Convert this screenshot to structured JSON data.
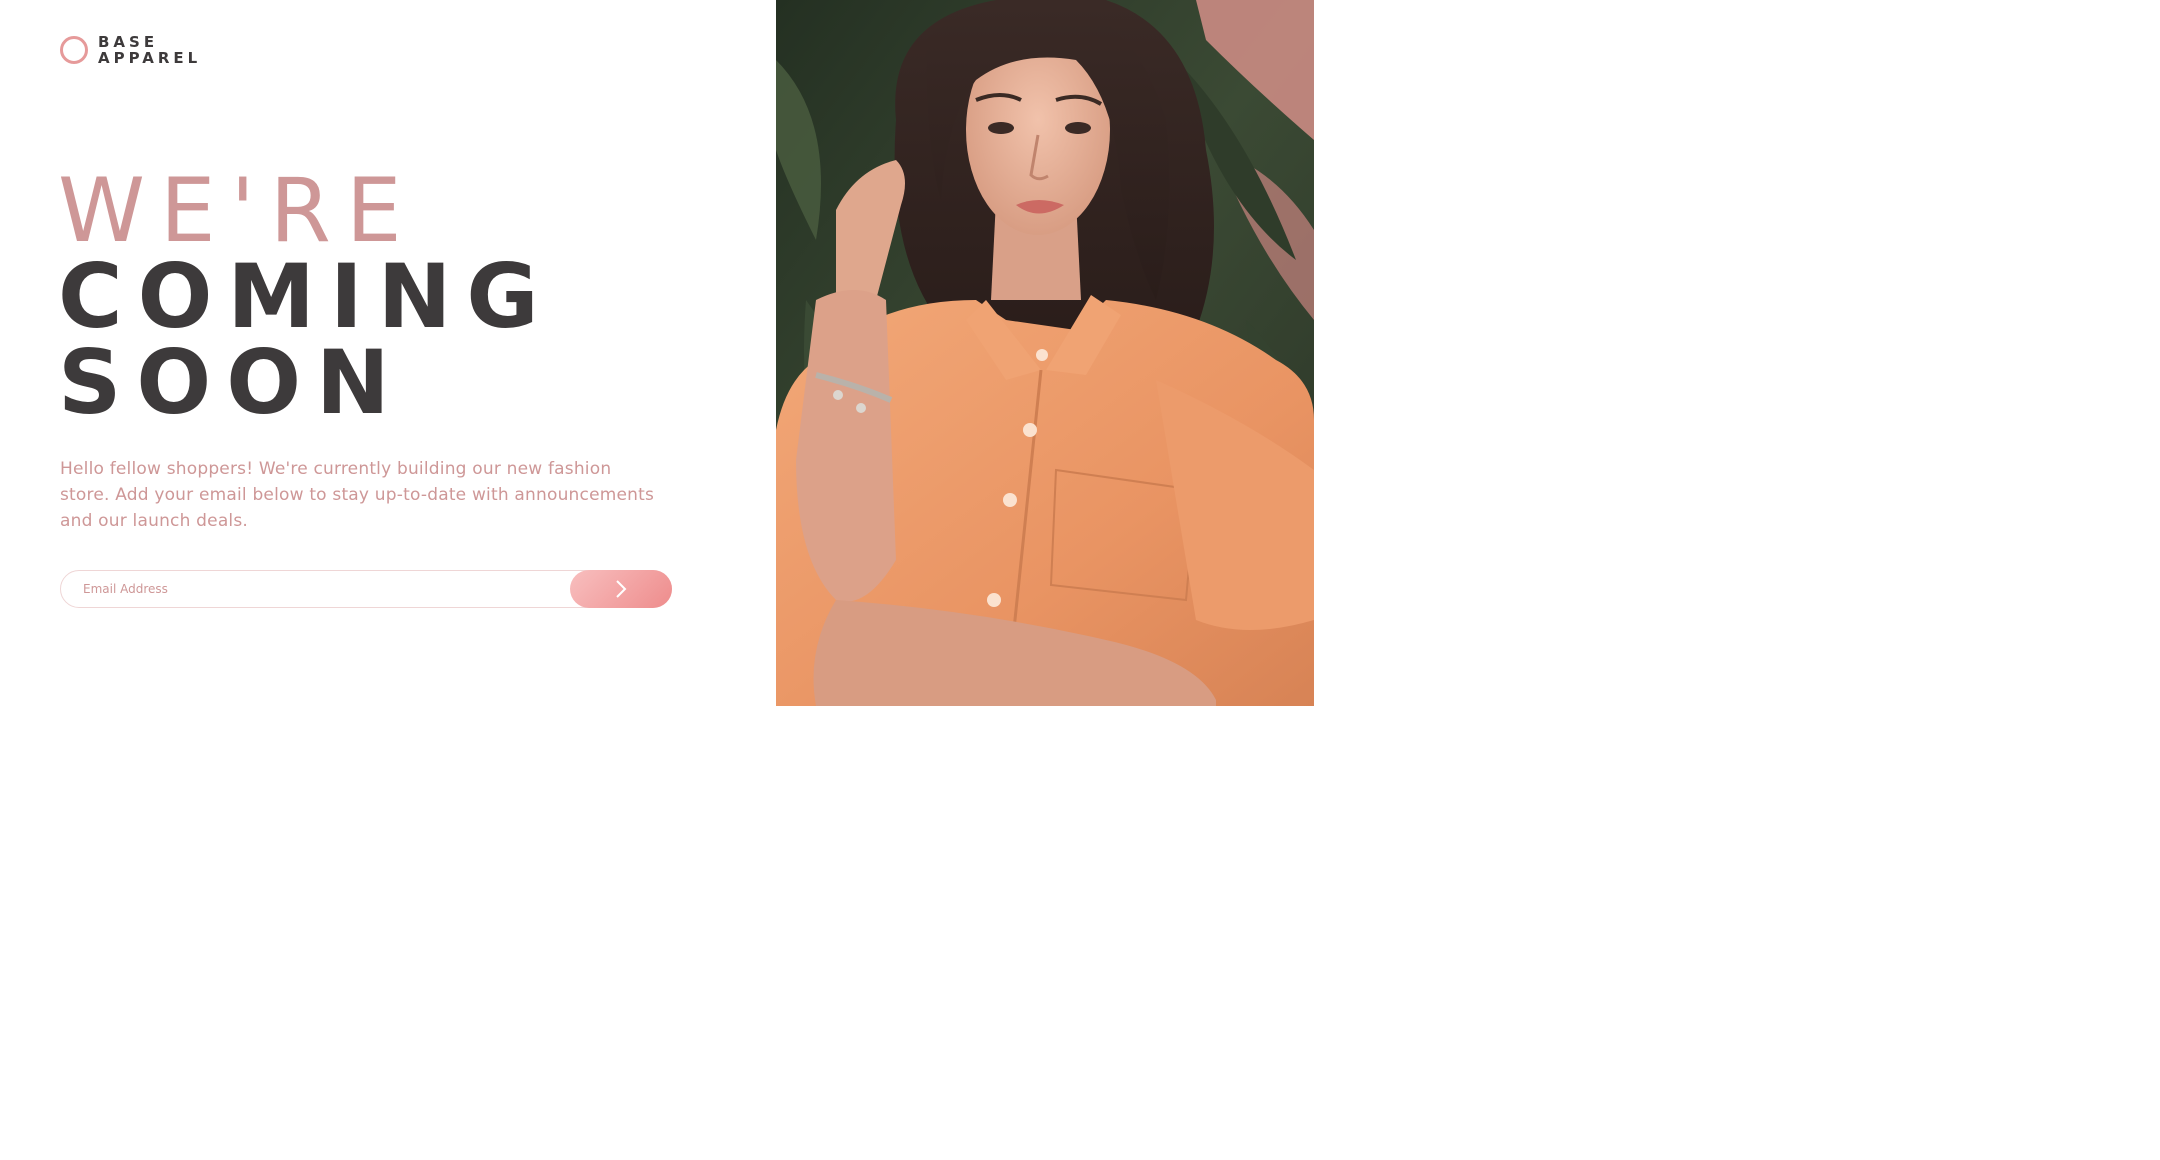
{
  "brand": {
    "line1": "BASE",
    "line2": "APPAREL",
    "logo_icon": "ring-icon",
    "accent_color": "#e69a9a"
  },
  "headline": {
    "line1": "WE'RE",
    "line2": "COMING",
    "line3": "SOON"
  },
  "description": "Hello fellow shoppers! We're currently building our new fashion store. Add your email below to stay up-to-date with announcements and our launch deals.",
  "form": {
    "email_placeholder": "Email Address",
    "submit_icon": "chevron-right-icon",
    "submit_label": "Submit"
  },
  "hero": {
    "image_alt": "Woman in an orange shirt posing among tropical leaves"
  },
  "colors": {
    "primary_text": "#3d3a3b",
    "accent_text": "#ce9797",
    "button_gradient_start": "#f8bfbf",
    "button_gradient_end": "#ee8c8c"
  }
}
